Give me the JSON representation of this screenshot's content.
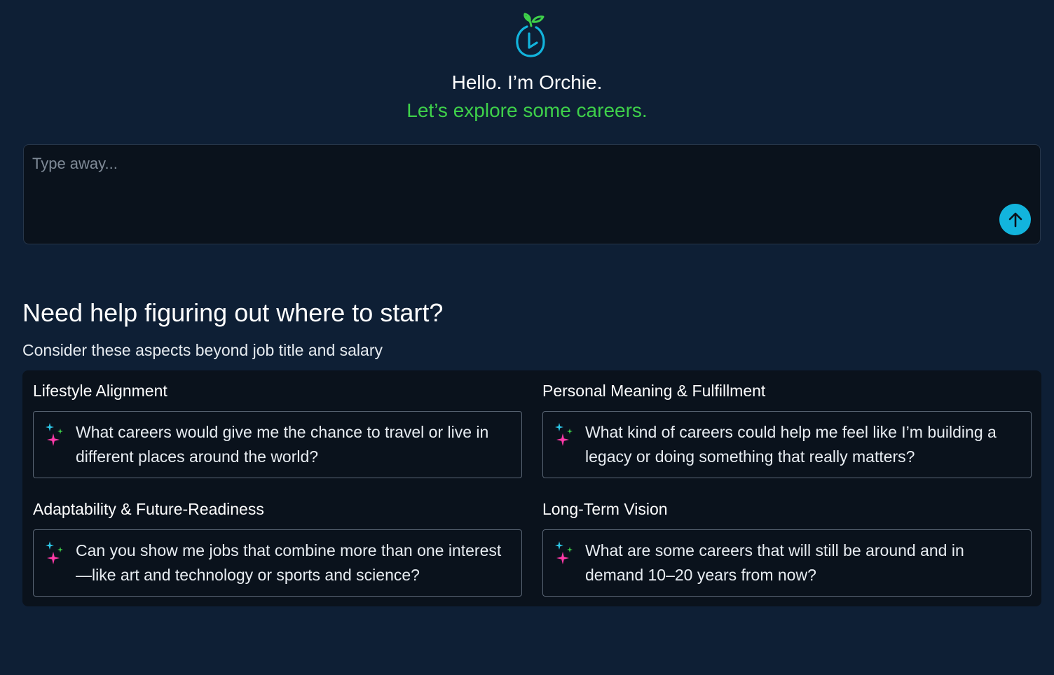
{
  "header": {
    "logo_icon": "orchie-logo-icon",
    "greeting": "Hello. I’m Orchie.",
    "tagline": "Let’s explore some careers."
  },
  "chat": {
    "placeholder": "Type away...",
    "value": "",
    "send_icon": "arrow-up-icon"
  },
  "help": {
    "heading": "Need help figuring out where to start?",
    "subheading": "Consider these aspects beyond job title and salary",
    "categories": [
      {
        "title": "Lifestyle Alignment",
        "prompt": "What careers would give me the chance to travel or live in different places around the world?"
      },
      {
        "title": "Personal Meaning & Fulfillment",
        "prompt": "What kind of careers could help me feel like I’m building a legacy or doing something that really matters?"
      },
      {
        "title": "Adaptability & Future-Readiness",
        "prompt": "Can you show me jobs that combine more than one interest—like art and technology or sports and science?"
      },
      {
        "title": "Long-Term Vision",
        "prompt": "What are some careers that will still be around and in demand 10–20 years from now?"
      }
    ]
  },
  "colors": {
    "background": "#0e1f35",
    "panel": "#0a121c",
    "accent_green": "#3ed04a",
    "accent_blue": "#12b4dd",
    "sparkle_pink": "#ff3aa8",
    "sparkle_cyan": "#2ec8e8",
    "sparkle_green": "#3ed04a"
  }
}
